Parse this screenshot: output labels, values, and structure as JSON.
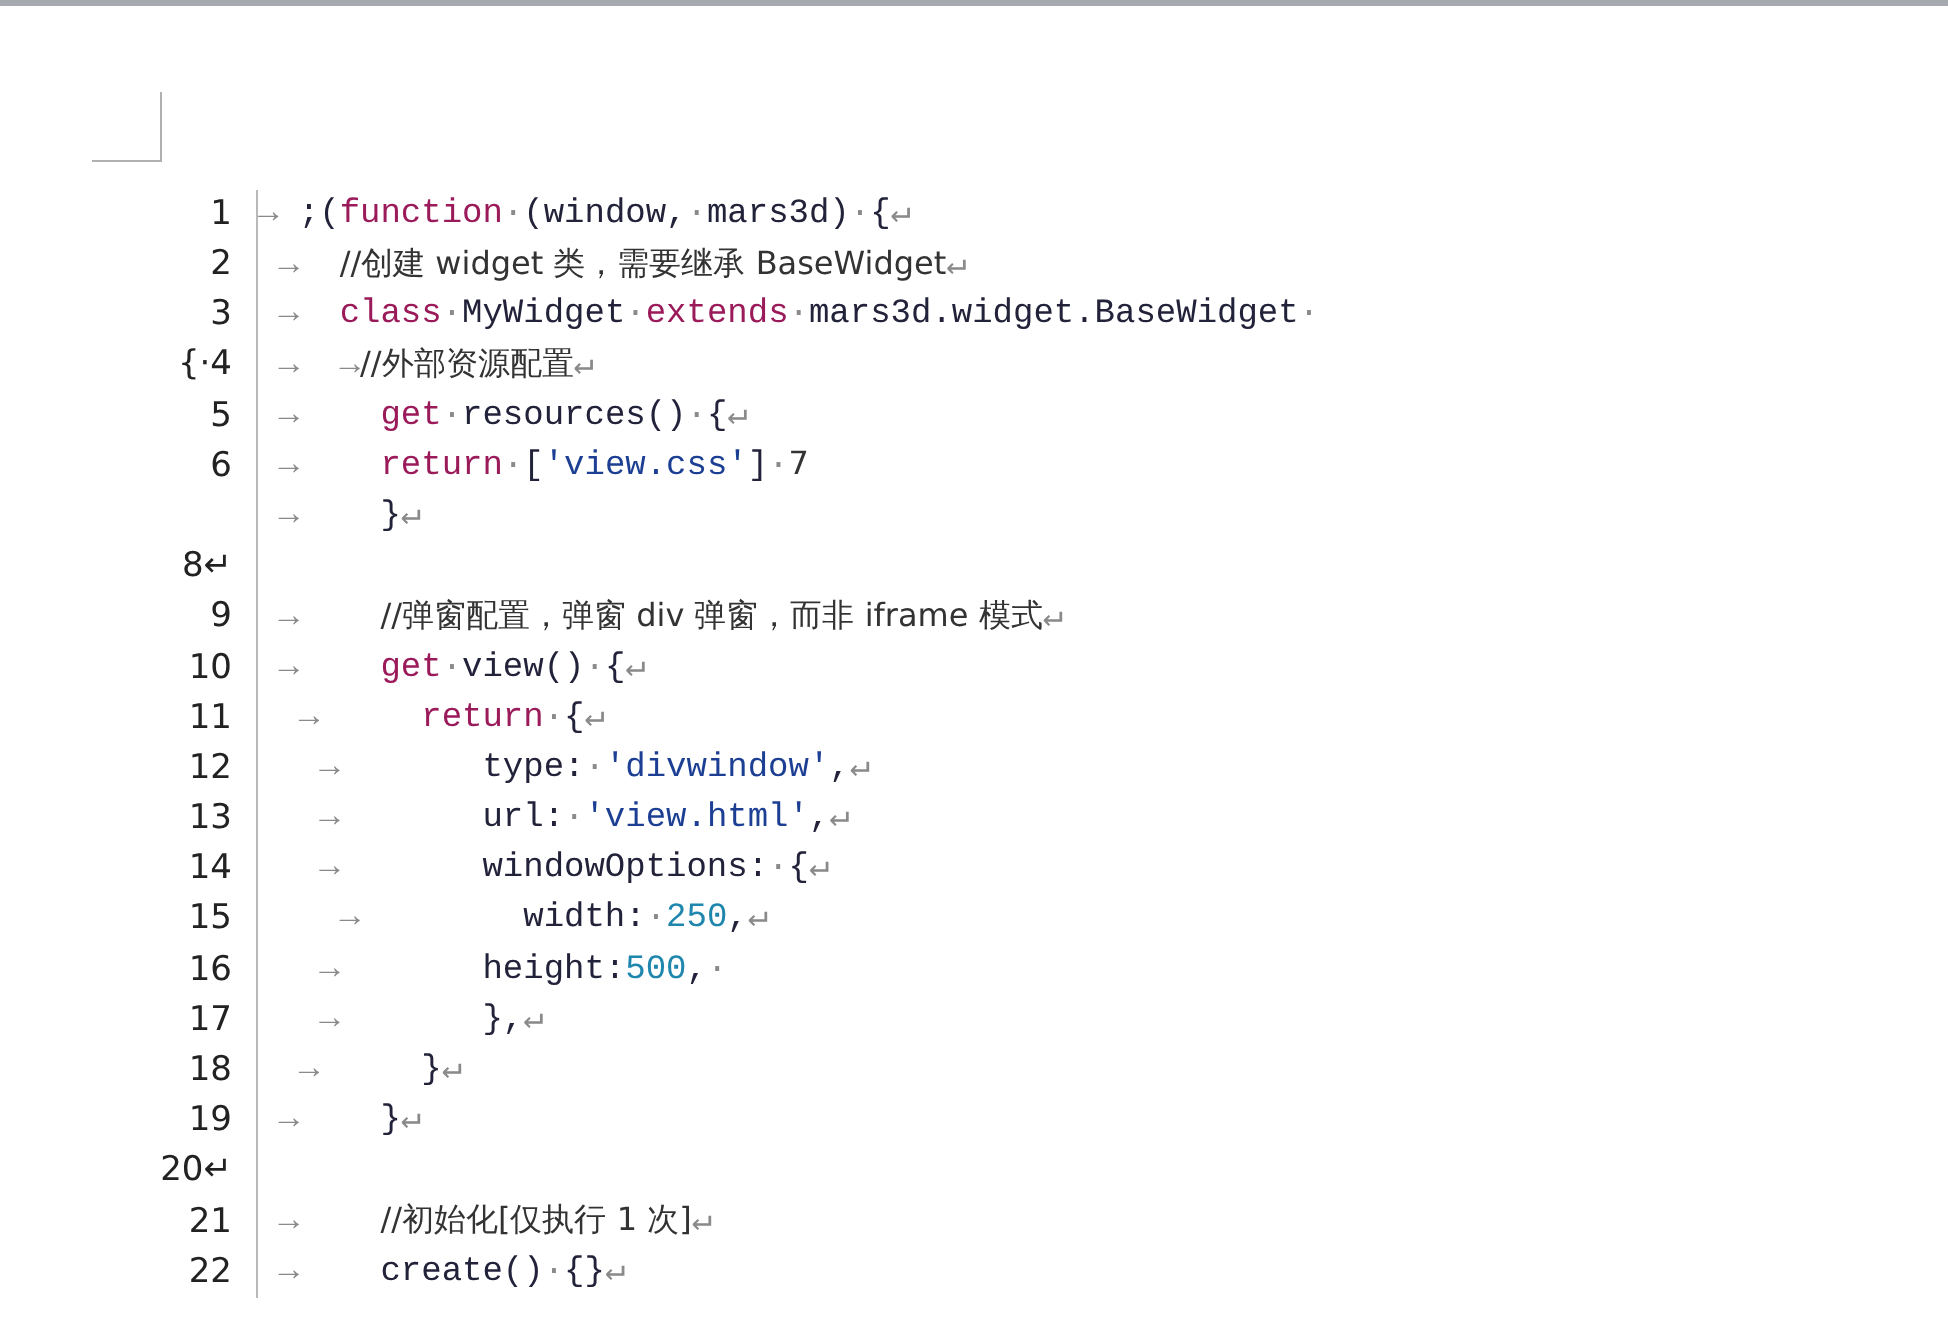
{
  "document": {
    "rows": [
      {
        "gutter": "1",
        "code": [
          {
            "kind": "mark",
            "text": "→"
          },
          {
            "kind": "plain",
            "text": " ;("
          },
          {
            "kind": "kw",
            "text": "function"
          },
          {
            "kind": "mark",
            "text": "·"
          },
          {
            "kind": "plain",
            "text": "(window,"
          },
          {
            "kind": "mark",
            "text": "·"
          },
          {
            "kind": "plain",
            "text": "mars3d)"
          },
          {
            "kind": "mark",
            "text": "·"
          },
          {
            "kind": "plain",
            "text": "{"
          },
          {
            "kind": "mark",
            "text": "↵"
          }
        ]
      },
      {
        "gutter": "2",
        "code": [
          {
            "kind": "mark",
            "text": " →  "
          },
          {
            "kind": "comment",
            "text": "//创建 widget 类，需要继承 BaseWidget"
          },
          {
            "kind": "mark",
            "text": "↵"
          }
        ]
      },
      {
        "gutter": "3",
        "code": [
          {
            "kind": "mark",
            "text": " →  "
          },
          {
            "kind": "kw",
            "text": "class"
          },
          {
            "kind": "mark",
            "text": "·"
          },
          {
            "kind": "plain",
            "text": "MyWidget"
          },
          {
            "kind": "mark",
            "text": "·"
          },
          {
            "kind": "kw",
            "text": "extends"
          },
          {
            "kind": "mark",
            "text": "·"
          },
          {
            "kind": "plain",
            "text": "mars3d.widget.BaseWidget"
          },
          {
            "kind": "mark",
            "text": "·"
          }
        ]
      },
      {
        "gutter": "{·4",
        "code": [
          {
            "kind": "mark",
            "text": " →  →"
          },
          {
            "kind": "comment",
            "text": "//外部资源配置"
          },
          {
            "kind": "mark",
            "text": "↵"
          }
        ]
      },
      {
        "gutter": "5",
        "code": [
          {
            "kind": "mark",
            "text": " →    "
          },
          {
            "kind": "kw",
            "text": "get"
          },
          {
            "kind": "mark",
            "text": "·"
          },
          {
            "kind": "plain",
            "text": "resources()"
          },
          {
            "kind": "mark",
            "text": "·"
          },
          {
            "kind": "plain",
            "text": "{"
          },
          {
            "kind": "mark",
            "text": "↵"
          }
        ]
      },
      {
        "gutter": "6",
        "code": [
          {
            "kind": "mark",
            "text": " →    "
          },
          {
            "kind": "kw",
            "text": "return"
          },
          {
            "kind": "mark",
            "text": "·"
          },
          {
            "kind": "plain",
            "text": "["
          },
          {
            "kind": "str",
            "text": "'view.css'"
          },
          {
            "kind": "plain",
            "text": "]"
          },
          {
            "kind": "mark",
            "text": "·"
          },
          {
            "kind": "comment",
            "text": "7"
          }
        ]
      },
      {
        "gutter": "",
        "code": [
          {
            "kind": "mark",
            "text": " →    "
          },
          {
            "kind": "plain",
            "text": "}"
          },
          {
            "kind": "mark",
            "text": "↵"
          }
        ]
      },
      {
        "gutter": "8↵",
        "code": []
      },
      {
        "gutter": "9",
        "code": [
          {
            "kind": "mark",
            "text": " →    "
          },
          {
            "kind": "comment",
            "text": "//弹窗配置，弹窗 div 弹窗，而非 iframe 模式"
          },
          {
            "kind": "mark",
            "text": "↵"
          }
        ]
      },
      {
        "gutter": "10",
        "code": [
          {
            "kind": "mark",
            "text": " →    "
          },
          {
            "kind": "kw",
            "text": "get"
          },
          {
            "kind": "mark",
            "text": "·"
          },
          {
            "kind": "plain",
            "text": "view()"
          },
          {
            "kind": "mark",
            "text": "·"
          },
          {
            "kind": "plain",
            "text": "{"
          },
          {
            "kind": "mark",
            "text": "↵"
          }
        ]
      },
      {
        "gutter": "11",
        "code": [
          {
            "kind": "mark",
            "text": "  →     "
          },
          {
            "kind": "kw",
            "text": "return"
          },
          {
            "kind": "mark",
            "text": "·"
          },
          {
            "kind": "plain",
            "text": "{"
          },
          {
            "kind": "mark",
            "text": "↵"
          }
        ]
      },
      {
        "gutter": "12",
        "code": [
          {
            "kind": "mark",
            "text": "   →       "
          },
          {
            "kind": "plain",
            "text": "type:"
          },
          {
            "kind": "mark",
            "text": "·"
          },
          {
            "kind": "str",
            "text": "'divwindow'"
          },
          {
            "kind": "plain",
            "text": ","
          },
          {
            "kind": "mark",
            "text": "↵"
          }
        ]
      },
      {
        "gutter": "13",
        "code": [
          {
            "kind": "mark",
            "text": "   →       "
          },
          {
            "kind": "plain",
            "text": "url:"
          },
          {
            "kind": "mark",
            "text": "·"
          },
          {
            "kind": "str",
            "text": "'view.html'"
          },
          {
            "kind": "plain",
            "text": ","
          },
          {
            "kind": "mark",
            "text": "↵"
          }
        ]
      },
      {
        "gutter": "14",
        "code": [
          {
            "kind": "mark",
            "text": "   →       "
          },
          {
            "kind": "plain",
            "text": "windowOptions:"
          },
          {
            "kind": "mark",
            "text": "·"
          },
          {
            "kind": "plain",
            "text": "{"
          },
          {
            "kind": "mark",
            "text": "↵"
          }
        ]
      },
      {
        "gutter": "15",
        "code": [
          {
            "kind": "mark",
            "text": "    →        "
          },
          {
            "kind": "plain",
            "text": "width:"
          },
          {
            "kind": "mark",
            "text": "·"
          },
          {
            "kind": "num",
            "text": "250"
          },
          {
            "kind": "plain",
            "text": ","
          },
          {
            "kind": "mark",
            "text": "↵"
          }
        ]
      },
      {
        "gutter": "16",
        "code": [
          {
            "kind": "mark",
            "text": "   →       "
          },
          {
            "kind": "plain",
            "text": "height:"
          },
          {
            "kind": "num",
            "text": "500"
          },
          {
            "kind": "plain",
            "text": ","
          },
          {
            "kind": "mark",
            "text": "·"
          }
        ]
      },
      {
        "gutter": "17",
        "code": [
          {
            "kind": "mark",
            "text": "   →       "
          },
          {
            "kind": "plain",
            "text": "},"
          },
          {
            "kind": "mark",
            "text": "↵"
          }
        ]
      },
      {
        "gutter": "18",
        "code": [
          {
            "kind": "mark",
            "text": "  →     "
          },
          {
            "kind": "plain",
            "text": "}"
          },
          {
            "kind": "mark",
            "text": "↵"
          }
        ]
      },
      {
        "gutter": "19",
        "code": [
          {
            "kind": "mark",
            "text": " →    "
          },
          {
            "kind": "plain",
            "text": "}"
          },
          {
            "kind": "mark",
            "text": "↵"
          }
        ]
      },
      {
        "gutter": "20↵",
        "code": []
      },
      {
        "gutter": "21",
        "code": [
          {
            "kind": "mark",
            "text": " →    "
          },
          {
            "kind": "comment",
            "text": "//初始化[仅执行 1 次]"
          },
          {
            "kind": "mark",
            "text": "↵"
          }
        ]
      },
      {
        "gutter": "22",
        "code": [
          {
            "kind": "mark",
            "text": " →    "
          },
          {
            "kind": "plain",
            "text": "create()"
          },
          {
            "kind": "mark",
            "text": "·"
          },
          {
            "kind": "plain",
            "text": "{}"
          },
          {
            "kind": "mark",
            "text": "↵"
          }
        ]
      }
    ]
  }
}
